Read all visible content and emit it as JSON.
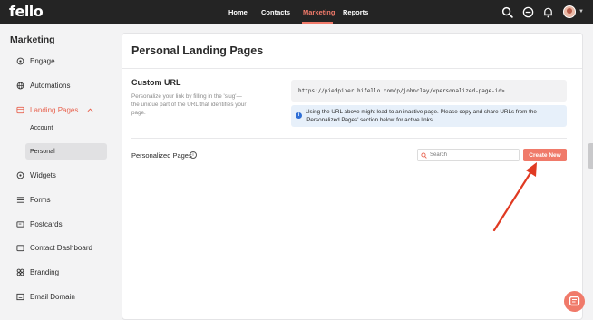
{
  "app": {
    "logo": "fello"
  },
  "topnav": {
    "items": [
      {
        "label": "Home",
        "active": false
      },
      {
        "label": "Contacts",
        "active": false
      },
      {
        "label": "Marketing",
        "active": true
      },
      {
        "label": "Reports",
        "active": false
      }
    ],
    "icons": [
      "search-icon",
      "clock-icon",
      "bell-icon",
      "avatar"
    ]
  },
  "sidebar": {
    "title": "Marketing",
    "items": [
      {
        "label": "Engage",
        "icon": "target-icon"
      },
      {
        "label": "Automations",
        "icon": "globe-icon"
      },
      {
        "label": "Landing Pages",
        "icon": "landing-pages-icon",
        "expanded": true,
        "active": true
      },
      {
        "label": "Widgets",
        "icon": "widget-icon"
      },
      {
        "label": "Forms",
        "icon": "form-icon"
      },
      {
        "label": "Postcards",
        "icon": "postcard-icon"
      },
      {
        "label": "Contact Dashboard",
        "icon": "dashboard-icon"
      },
      {
        "label": "Branding",
        "icon": "branding-icon"
      },
      {
        "label": "Email Domain",
        "icon": "email-domain-icon"
      }
    ],
    "subitems": [
      {
        "label": "Account",
        "active": false
      },
      {
        "label": "Personal",
        "active": true
      }
    ]
  },
  "main": {
    "title": "Personal Landing Pages",
    "custom_url": {
      "title": "Custom URL",
      "description": "Personalize your link by filling in the 'slug'—the unique part of the URL that identifies your page.",
      "url": "https://piedpiper.hifello.com/p/johnclay/<personalized-page-id>",
      "info": "Using the URL above might lead to an inactive page. Please copy and share URLs from the 'Personalized Pages' section below for active links."
    },
    "personalized_pages": {
      "label": "Personalized Pages",
      "search_placeholder": "Search",
      "create_button": "Create New"
    }
  },
  "colors": {
    "accent": "#f07a6a",
    "nav_bg": "#242424",
    "info_bg": "#e7f0fa",
    "arrow": "#e03a22"
  }
}
